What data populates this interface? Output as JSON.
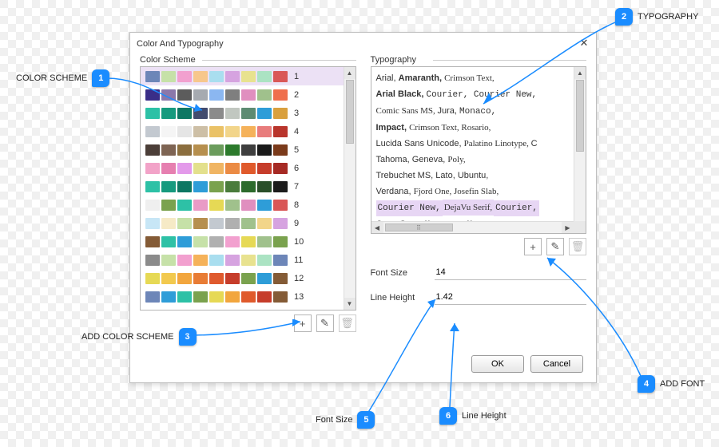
{
  "dialog_title": "Color And Typography",
  "groups": {
    "color": "Color Scheme",
    "typo": "Typography"
  },
  "schemes": [
    {
      "n": "1",
      "c": [
        "#6d86b8",
        "#c6e1a8",
        "#f2a0cf",
        "#f7c78c",
        "#a9deef",
        "#d6a3e0",
        "#e8e28f",
        "#abe3c3",
        "#d95757"
      ],
      "sel": true
    },
    {
      "n": "2",
      "c": [
        "#3a2e88",
        "#8b78aa",
        "#5c5c5c",
        "#a6aab0",
        "#8bb7f1",
        "#7f7f7f",
        "#e08fbf",
        "#a0c18c",
        "#ef6f4c"
      ]
    },
    {
      "n": "3",
      "c": [
        "#2dc1a6",
        "#169a7e",
        "#0d7763",
        "#424b6e",
        "#8b8b8b",
        "#c1c7c0",
        "#5d8b72",
        "#2e9dd8",
        "#d9a03e"
      ]
    },
    {
      "n": "4",
      "c": [
        "#c3c9d0",
        "#f5f5f5",
        "#e5e5e5",
        "#cdbfa6",
        "#eac267",
        "#f2d58a",
        "#f5b25a",
        "#e87c7c",
        "#b9352c"
      ]
    },
    {
      "n": "5",
      "c": [
        "#4b3e38",
        "#7e6453",
        "#8b6e3e",
        "#b68f4e",
        "#6b9c5c",
        "#2c7a2c",
        "#3e3e3e",
        "#1a1a1a",
        "#7a3a1a"
      ]
    },
    {
      "n": "6",
      "c": [
        "#f2a3c8",
        "#e67fb0",
        "#e39aea",
        "#e3e08c",
        "#f0b563",
        "#eb8b44",
        "#e05a2c",
        "#c63d2b",
        "#a62a24"
      ]
    },
    {
      "n": "7",
      "c": [
        "#2dc1a6",
        "#169a7e",
        "#0d7763",
        "#2e9dd8",
        "#7aa24e",
        "#4a7c3c",
        "#2c6b2c",
        "#2a4f2a",
        "#1c1c1c"
      ]
    },
    {
      "n": "8",
      "c": [
        "#efefef",
        "#7aa24e",
        "#2dc1a6",
        "#e99bc6",
        "#e6d955",
        "#a0c18c",
        "#e08fbf",
        "#2e9dd8",
        "#d95757"
      ]
    },
    {
      "n": "9",
      "c": [
        "#c7e6f6",
        "#f6eac6",
        "#c6e1a8",
        "#b68f4e",
        "#c3c9d0",
        "#b0b0b0",
        "#a0c18c",
        "#f2d58a",
        "#d6a3e0"
      ]
    },
    {
      "n": "10",
      "c": [
        "#845b36",
        "#2dc1a6",
        "#2e9dd8",
        "#c6e1a8",
        "#b0b0b0",
        "#f2a0cf",
        "#e6d955",
        "#a0c18c",
        "#7aa24e"
      ]
    },
    {
      "n": "11",
      "c": [
        "#8b8b8b",
        "#c6e1a8",
        "#f2a0cf",
        "#f5b25a",
        "#a9deef",
        "#d6a3e0",
        "#e8e28f",
        "#abe3c3",
        "#6d86b8"
      ]
    },
    {
      "n": "12",
      "c": [
        "#e6d955",
        "#f2c94e",
        "#f2a63e",
        "#e87c35",
        "#df5a2e",
        "#c63d2b",
        "#7aa24e",
        "#2e9dd8",
        "#845b36"
      ]
    },
    {
      "n": "13",
      "c": [
        "#6d86b8",
        "#2e9dd8",
        "#2dc1a6",
        "#7aa24e",
        "#e6d955",
        "#f2a63e",
        "#e05a2c",
        "#c63d2b",
        "#845b36"
      ]
    }
  ],
  "typo_lines": [
    [
      {
        "t": "Arial,",
        "cls": "tf"
      },
      {
        "t": "Amaranth,",
        "cls": "bold"
      },
      {
        "t": "Crimson Text,",
        "cls": "serif"
      }
    ],
    [
      {
        "t": "Arial Black,",
        "cls": "bold"
      },
      {
        "t": "Courier,",
        "cls": "mono"
      },
      {
        "t": "Courier New,",
        "cls": "mono"
      }
    ],
    [
      {
        "t": "Comic Sans MS,",
        "cls": "comic"
      },
      {
        "t": "Jura,",
        "cls": "tf"
      },
      {
        "t": "Monaco,",
        "cls": "mono"
      }
    ],
    [
      {
        "t": "Impact,",
        "cls": "bold"
      },
      {
        "t": "Crimson Text,",
        "cls": "serif"
      },
      {
        "t": "Rosario,",
        "cls": "serif"
      }
    ],
    [
      {
        "t": "Lucida Sans Unicode,",
        "cls": "tf"
      },
      {
        "t": "Palatino Linotype,",
        "cls": "serif"
      },
      {
        "t": "C",
        "cls": "tf"
      }
    ],
    [
      {
        "t": "Tahoma,",
        "cls": "tf"
      },
      {
        "t": "Geneva,",
        "cls": "tf"
      },
      {
        "t": "Poly,",
        "cls": "serif"
      }
    ],
    [
      {
        "t": "Trebuchet MS,",
        "cls": "tf"
      },
      {
        "t": "Lato,",
        "cls": "tf"
      },
      {
        "t": "Ubuntu,",
        "cls": "tf"
      }
    ],
    [
      {
        "t": "Verdana,",
        "cls": "tf"
      },
      {
        "t": "Fjord One,",
        "cls": "serif"
      },
      {
        "t": "Josefin Slab,",
        "cls": "serif"
      }
    ],
    [
      {
        "t": "Courier New,",
        "cls": "mono sel"
      },
      {
        "t": "DejaVu Serif,",
        "cls": "serif sel"
      },
      {
        "t": "Courier,",
        "cls": "mono sel"
      }
    ],
    [
      {
        "t": "Open Sans,",
        "cls": "tf"
      },
      {
        "t": "Monaco,",
        "cls": "mono"
      },
      {
        "t": "Monospace,",
        "cls": "mono"
      }
    ]
  ],
  "fields": {
    "font_size": {
      "label": "Font Size",
      "value": "14"
    },
    "line_height": {
      "label": "Line Height",
      "value": "1.42"
    }
  },
  "buttons": {
    "ok": "OK",
    "cancel": "Cancel"
  },
  "tool_icons": {
    "add": "+",
    "edit": "✎",
    "delete": "🗑"
  },
  "callouts": {
    "c1": {
      "n": "1",
      "label": "COLOR SCHEME"
    },
    "c2": {
      "n": "2",
      "label": "TYPOGRAPHY"
    },
    "c3": {
      "n": "3",
      "label": "ADD COLOR SCHEME"
    },
    "c4": {
      "n": "4",
      "label": "ADD FONT"
    },
    "c5": {
      "n": "5",
      "label": "Font Size"
    },
    "c6": {
      "n": "6",
      "label": "Line Height"
    }
  }
}
